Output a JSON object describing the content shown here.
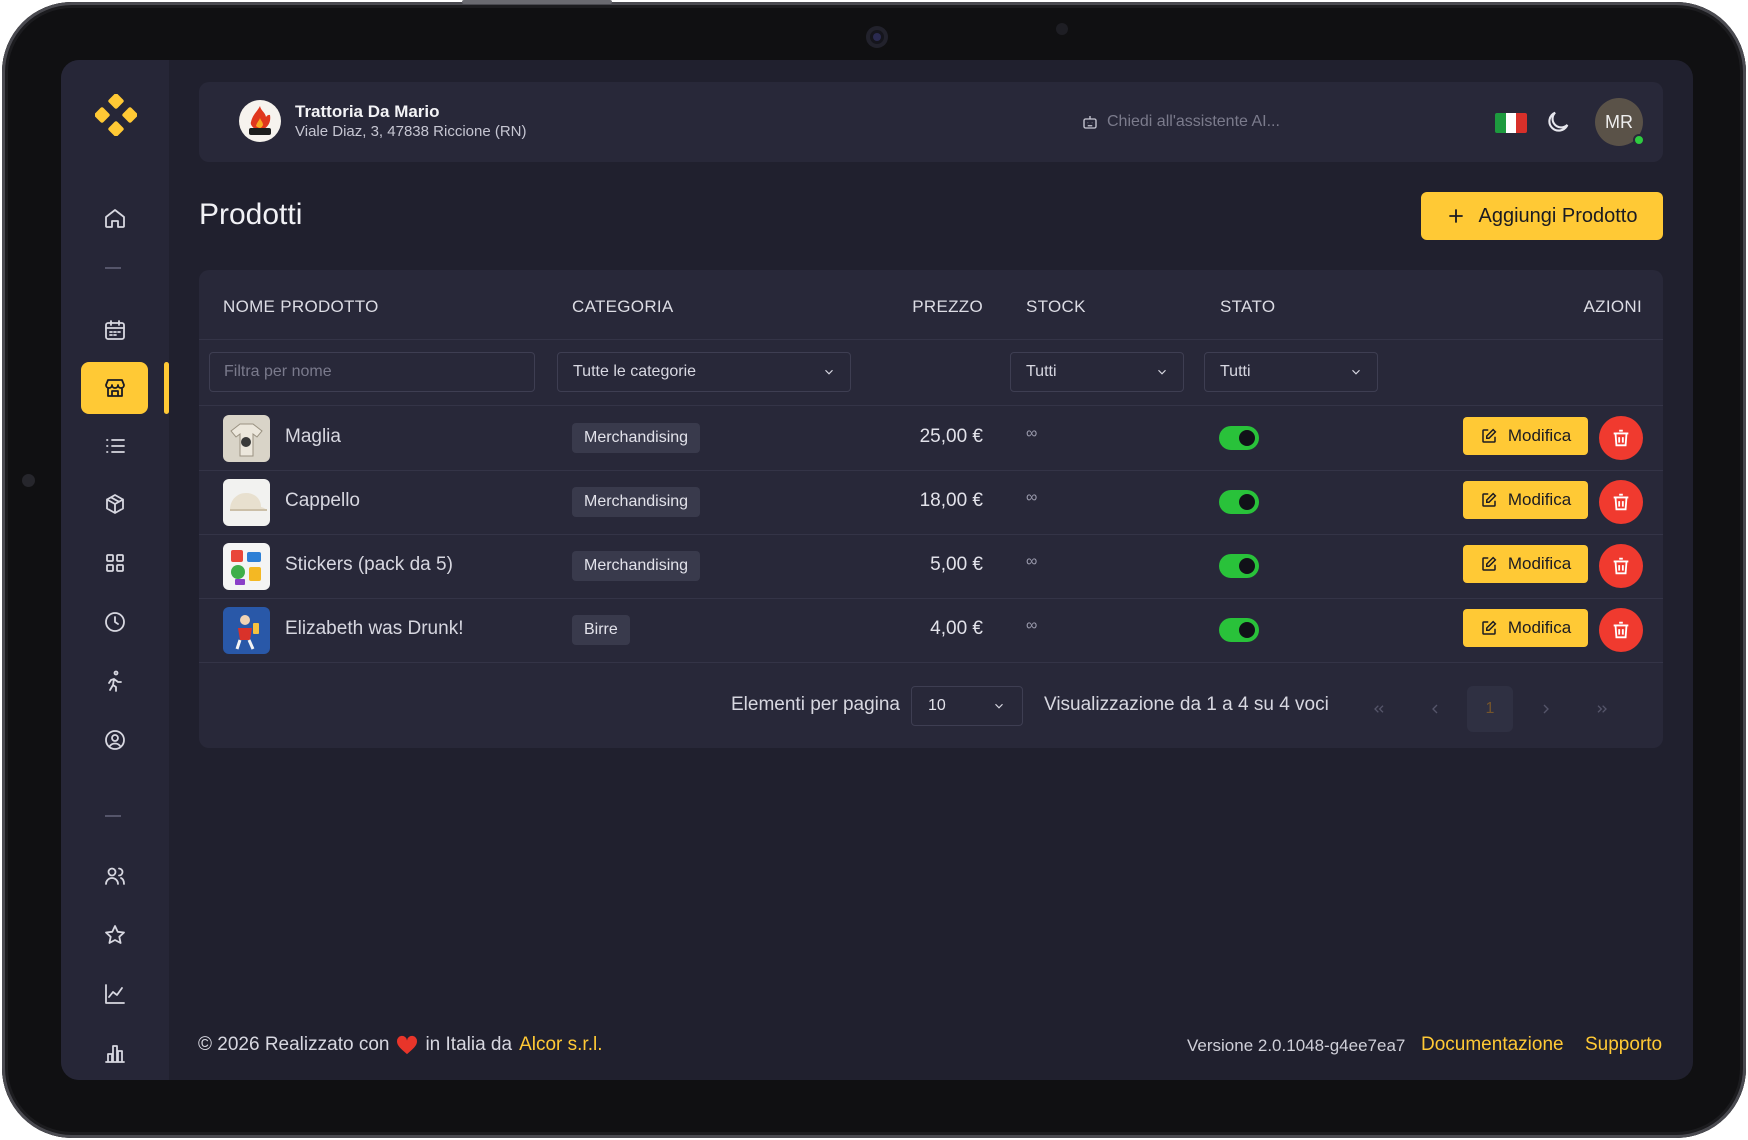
{
  "sidebar": {
    "items": [
      {
        "name": "home-icon",
        "active": false
      },
      {
        "name": "calendar-icon",
        "active": false
      },
      {
        "name": "store-icon",
        "active": true
      },
      {
        "name": "list-icon",
        "active": false
      },
      {
        "name": "box-icon",
        "active": false
      },
      {
        "name": "grid-icon",
        "active": false
      },
      {
        "name": "clock-icon",
        "active": false
      },
      {
        "name": "running-icon",
        "active": false
      },
      {
        "name": "user-circle-icon",
        "active": false
      },
      {
        "name": "users-icon",
        "active": false
      },
      {
        "name": "star-icon",
        "active": false
      },
      {
        "name": "line-chart-icon",
        "active": false
      },
      {
        "name": "bar-chart-icon",
        "active": false
      }
    ]
  },
  "header": {
    "restaurant_name": "Trattoria Da Mario",
    "restaurant_address": "Viale Diaz, 3, 47838 Riccione (RN)",
    "ai_placeholder": "Chiedi all'assistente AI...",
    "avatar_initials": "MR",
    "language_flag": "italy-flag"
  },
  "page": {
    "title": "Prodotti",
    "add_button_label": "Aggiungi Prodotto"
  },
  "table": {
    "columns": {
      "name": "NOME PRODOTTO",
      "category": "CATEGORIA",
      "price": "PREZZO",
      "stock": "STOCK",
      "status": "STATO",
      "actions": "AZIONI"
    },
    "filters": {
      "name_placeholder": "Filtra per nome",
      "category_value": "Tutte le categorie",
      "stock_value": "Tutti",
      "status_value": "Tutti"
    },
    "rows": [
      {
        "name": "Maglia",
        "category": "Merchandising",
        "price": "25,00 €",
        "stock": "∞",
        "active": true,
        "edit_label": "Modifica"
      },
      {
        "name": "Cappello",
        "category": "Merchandising",
        "price": "18,00 €",
        "stock": "∞",
        "active": true,
        "edit_label": "Modifica"
      },
      {
        "name": "Stickers (pack da 5)",
        "category": "Merchandising",
        "price": "5,00 €",
        "stock": "∞",
        "active": true,
        "edit_label": "Modifica"
      },
      {
        "name": "Elizabeth was Drunk!",
        "category": "Birre",
        "price": "4,00 €",
        "stock": "∞",
        "active": true,
        "edit_label": "Modifica"
      }
    ],
    "pagination": {
      "per_page_label": "Elementi per pagina",
      "per_page_value": "10",
      "summary": "Visualizzazione da 1 a 4 su 4 voci",
      "current_page": "1"
    }
  },
  "footer": {
    "copyright_prefix": "© 2026 Realizzato con",
    "copyright_middle": "in Italia da",
    "company": "Alcor s.r.l.",
    "version": "Versione 2.0.1048-g4ee7ea7",
    "docs_label": "Documentazione",
    "support_label": "Supporto"
  },
  "colors": {
    "accent": "#ffc935",
    "danger": "#f03a2f",
    "toggle_on": "#29c23a",
    "background": "#20202e",
    "card": "#282839"
  }
}
